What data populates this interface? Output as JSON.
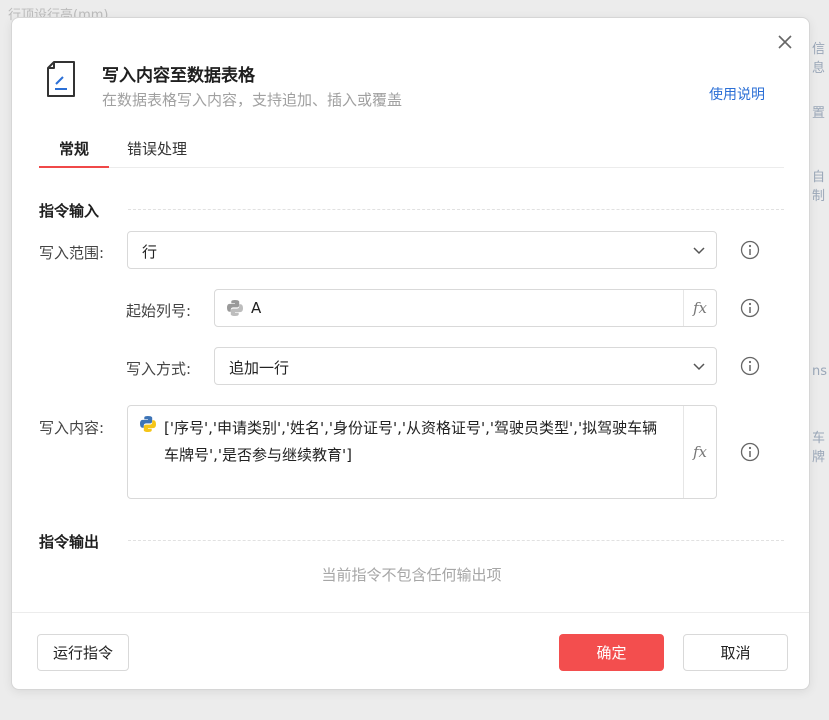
{
  "background": {
    "hints": [
      "行顶设行高(mm)",
      "信息",
      "置",
      "自制",
      "ns",
      "车牌"
    ]
  },
  "dialog": {
    "title": "写入内容至数据表格",
    "subtitle": "在数据表格写入内容，支持追加、插入或覆盖",
    "help_link": "使用说明",
    "tabs": [
      "常规",
      "错误处理"
    ]
  },
  "input_section": {
    "title": "指令输入",
    "write_range": {
      "label": "写入范围:",
      "value": "行"
    },
    "start_column": {
      "label": "起始列号:",
      "value": "A"
    },
    "write_mode": {
      "label": "写入方式:",
      "value": "追加一行"
    },
    "write_content": {
      "label": "写入内容:",
      "value": "['序号','申请类别','姓名','身份证号','从资格证号','驾驶员类型','拟驾驶车辆车牌号','是否参与继续教育']"
    }
  },
  "output_section": {
    "title": "指令输出",
    "empty_text": "当前指令不包含任何输出项"
  },
  "footer": {
    "run_label": "运行指令",
    "ok_label": "确定",
    "cancel_label": "取消"
  },
  "fx_label": "fx",
  "icons": {
    "close": "close-icon",
    "document": "document-edit-icon",
    "dropdown": "chevron-down-icon",
    "info": "info-icon",
    "python": "python-icon"
  },
  "colors": {
    "accent": "#f04848",
    "primary_button": "#f34e4e",
    "link": "#2b6fd6",
    "python_blue": "#3d74b6",
    "python_yellow": "#f5c518"
  }
}
